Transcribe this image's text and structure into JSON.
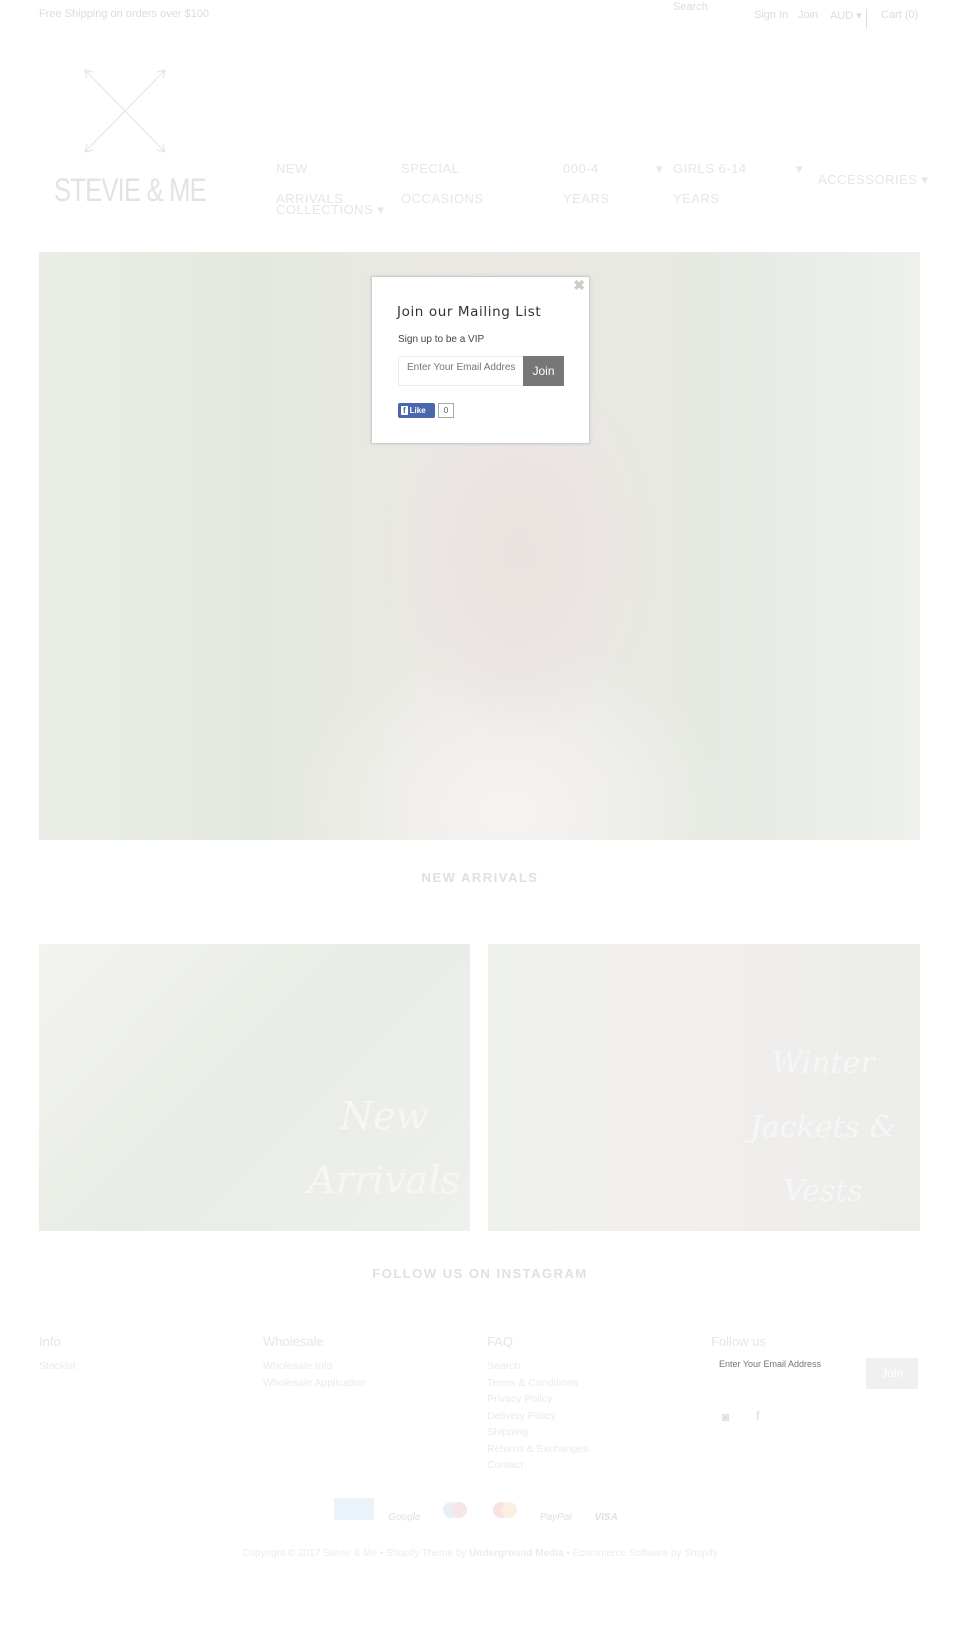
{
  "topbar": {
    "promo": "Free Shipping on orders over $100",
    "search_placeholder": "Search",
    "sign_in": "Sign In",
    "join": "Join",
    "currency": "AUD",
    "cart": "Cart (0)"
  },
  "logo": {
    "text": "STEVIE & ME"
  },
  "nav": [
    {
      "line1": "NEW",
      "line2": "ARRIVALS"
    },
    {
      "line1": "SPECIAL",
      "line2": "OCCASIONS"
    },
    {
      "line1": "000-4",
      "line2": "YEARS"
    },
    {
      "line1": "GIRLS 6-14",
      "line2": "YEARS"
    },
    {
      "line1": "ACCESSORIES"
    },
    {
      "line1": "COLLECTIONS"
    }
  ],
  "modal": {
    "title": "Join our Mailing List",
    "subtitle": "Sign up to be a VIP",
    "email_placeholder": "Enter Your Email Address",
    "join": "Join",
    "like": "Like",
    "like_count": "0"
  },
  "sections": {
    "new_arrivals": "NEW ARRIVALS",
    "instagram": "FOLLOW US ON INSTAGRAM"
  },
  "tiles": [
    {
      "label": "New Arrivals"
    },
    {
      "label": "Winter Jackets & Vests"
    }
  ],
  "footer": {
    "info": {
      "title": "Info",
      "links": [
        "Stockist"
      ]
    },
    "wholesale": {
      "title": "Wholesale",
      "links": [
        "Wholesale Info",
        "Wholesale Application"
      ]
    },
    "faq": {
      "title": "FAQ",
      "links": [
        "Search",
        "Terms & Conditions",
        "Privacy Policy",
        "Delivery Policy",
        "Shipping",
        "Returns & Exchanges",
        "Contact"
      ]
    },
    "follow": {
      "title": "Follow us",
      "email_placeholder": "Enter Your Email Address",
      "join": "Join"
    }
  },
  "payments": [
    "American Express",
    "Google",
    "Maestro",
    "MasterCard",
    "PayPal",
    "VISA"
  ],
  "copyright": {
    "text": "Copyright © 2017 Stevie & Me • ",
    "theme": "Shopify Theme",
    "by": " by ",
    "author": "Underground Media",
    "sep": " • ",
    "ecommerce": "Ecommerce Software by Shopify"
  }
}
